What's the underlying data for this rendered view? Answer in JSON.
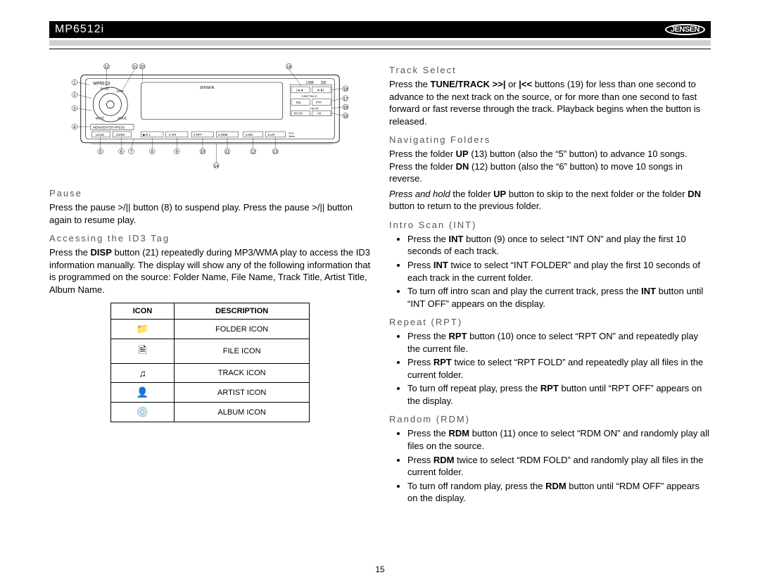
{
  "header": {
    "model": "MP6512i",
    "brand": "JENSEN"
  },
  "page_number": "15",
  "diagram": {
    "model_label": "MP6512i",
    "top_labels": {
      "faceplate": "JENSEN",
      "usb": "USB",
      "sd": "SD"
    },
    "bottom_row": [
      "LOUD",
      "LO/DX",
      "▶/II 1",
      "2 INT",
      "3 RPT",
      "4 RDM",
      "5 DN",
      "6 UP",
      "iPod Menu"
    ],
    "side_right": [
      "EQ",
      "PTY",
      "SCAN",
      "AS",
      "CH/CAT"
    ],
    "side_left_top": [
      "◄◄",
      "►►",
      "TUNE/TRACK"
    ],
    "menu_enter": "MENU/ENTER-PRESS",
    "knob_labels": [
      "BAND",
      "DISP",
      "MUTE",
      "MODE"
    ],
    "callouts": [
      "1",
      "2",
      "3",
      "4",
      "5",
      "6",
      "7",
      "8",
      "9",
      "10",
      "11",
      "12",
      "13",
      "14",
      "15",
      "16",
      "17",
      "18",
      "19",
      "20",
      "21",
      "22"
    ]
  },
  "left": {
    "pause": {
      "heading": "Pause",
      "body": "Press the pause >/|| button (8) to suspend play. Press the pause >/|| button again to resume play."
    },
    "id3": {
      "heading": "Accessing the ID3 Tag",
      "body_pre": "Press the ",
      "body_bold": "DISP",
      "body_post": " button (21) repeatedly during MP3/WMA play to access the ID3 information manually. The display will show any of the following information that is programmed on the source: Folder Name, File Name, Track Title, Artist Title, Album Name."
    },
    "table": {
      "head_icon": "ICON",
      "head_desc": "DESCRIPTION",
      "rows": [
        {
          "icon": "📁",
          "desc": "FOLDER ICON"
        },
        {
          "icon": "🗎",
          "desc": "FILE ICON"
        },
        {
          "icon": "♫",
          "desc": "TRACK ICON"
        },
        {
          "icon": "👤",
          "desc": "ARTIST ICON"
        },
        {
          "icon": "💿",
          "desc": "ALBUM ICON"
        }
      ]
    }
  },
  "right": {
    "track": {
      "heading": "Track Select",
      "b_pre": "Press the ",
      "b_bold": "TUNE/TRACK >>|",
      "b_mid": " or ",
      "b_bold2": "|<<",
      "b_post": " buttons (19) for less than one second to advance to the next track on the source, or for more than one second to fast forward or fast reverse through the track. Playback begins when the button is released."
    },
    "nav": {
      "heading": "Navigating Folders",
      "p1_pre": "Press the folder ",
      "p1_b1": "UP",
      "p1_mid": " (13) button (also the “5” button) to advance 10 songs. Press the folder ",
      "p1_b2": "DN",
      "p1_post": " (12) button (also the “6” button) to move 10 songs in reverse.",
      "p2_it": "Press and hold",
      "p2_mid": " the folder ",
      "p2_b1": "UP",
      "p2_mid2": " button to skip to the next folder or the folder ",
      "p2_b2": "DN",
      "p2_post": " button to return to the previous folder."
    },
    "int": {
      "heading": "Intro Scan (INT)",
      "li1_pre": "Press the ",
      "li1_b": "INT",
      "li1_post": " button (9) once to select “INT ON” and play the first 10 seconds of each track.",
      "li2_pre": "Press ",
      "li2_b": "INT",
      "li2_post": " twice to select “INT FOLDER” and play the first 10 seconds of each track in the current folder.",
      "li3_pre": "To turn off intro scan and play the current track, press the ",
      "li3_b": "INT",
      "li3_post": " button until “INT OFF” appears on the display."
    },
    "rpt": {
      "heading": "Repeat (RPT)",
      "li1_pre": "Press the ",
      "li1_b": "RPT",
      "li1_post": " button (10) once to select “RPT ON” and repeatedly play the current file.",
      "li2_pre": "Press ",
      "li2_b": "RPT",
      "li2_post": " twice to select “RPT FOLD” and repeatedly play all files in the current folder.",
      "li3_pre": "To turn off repeat play, press the ",
      "li3_b": "RPT",
      "li3_post": " button until “RPT OFF” appears on the display."
    },
    "rdm": {
      "heading": "Random (RDM)",
      "li1_pre": "Press the ",
      "li1_b": "RDM",
      "li1_post": " button (11) once to select “RDM ON” and randomly play all files on the source.",
      "li2_pre": "Press ",
      "li2_b": "RDM",
      "li2_post": " twice to select “RDM FOLD” and randomly play all files in the current folder.",
      "li3_pre": "To turn off random play, press the ",
      "li3_b": "RDM",
      "li3_post": " button until “RDM OFF” appears on the display."
    }
  }
}
